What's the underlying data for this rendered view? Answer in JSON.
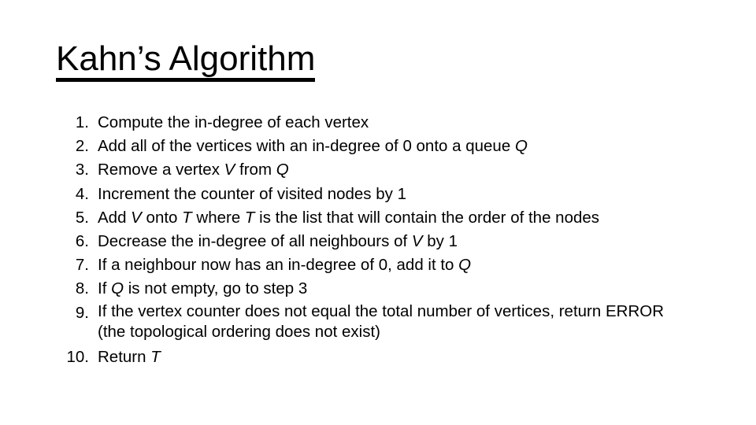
{
  "slide": {
    "title": "Kahn’s Algorithm",
    "background_color": "#ffffff",
    "text_color": "#000000",
    "steps": [
      {
        "number": "1.",
        "text_before": "Compute the in-degree of each vertex",
        "italic": "",
        "text_after": "",
        "continuation": ""
      },
      {
        "number": "2.",
        "text_before": "Add all of the vertices with an in-degree of 0 onto a queue ",
        "italic": "Q",
        "text_after": "",
        "continuation": ""
      },
      {
        "number": "3.",
        "text_before": "Remove a vertex ",
        "italic": "V",
        "text_after": " from ",
        "italic2": "Q",
        "continuation": ""
      },
      {
        "number": "4.",
        "text_before": "Increment the counter of visited nodes by 1",
        "italic": "",
        "text_after": "",
        "continuation": ""
      },
      {
        "number": "5.",
        "text_before": "Add ",
        "italic": "V",
        "text_after": " onto ",
        "italic2": "T",
        "text_after2": " where ",
        "italic3": "T",
        "text_after3": " is the list that will contain the order of the nodes",
        "continuation": ""
      },
      {
        "number": "6.",
        "text_before": "Decrease the in-degree of all neighbours of ",
        "italic": "V",
        "text_after": " by 1",
        "continuation": ""
      },
      {
        "number": "7.",
        "text_before": "If a neighbour now has an in-degree of 0, add it to ",
        "italic": "Q",
        "text_after": "",
        "continuation": ""
      },
      {
        "number": "8.",
        "text_before": "If ",
        "italic": "Q",
        "text_after": " is not empty, go to step 3",
        "continuation": ""
      },
      {
        "number": "9.",
        "text_before": "If the vertex counter does not equal the total number of vertices, return ERROR",
        "italic": "",
        "text_after": "",
        "continuation": "(the topological ordering does not exist)"
      },
      {
        "number": "10.",
        "text_before": "Return ",
        "italic": "T",
        "text_after": "",
        "continuation": ""
      }
    ]
  }
}
